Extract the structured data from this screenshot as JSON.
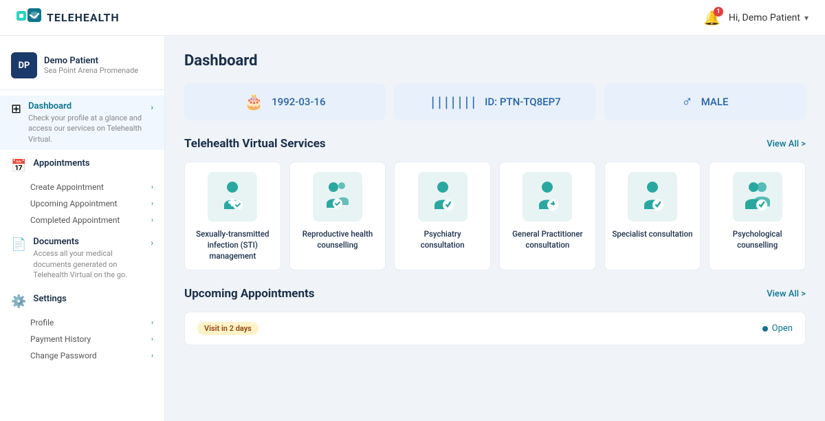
{
  "header": {
    "logo_text": "TELEHEALTH",
    "notification_badge": "1",
    "user_greeting": "Hi, Demo Patient"
  },
  "sidebar": {
    "user_initials": "DP",
    "user_name": "Demo Patient",
    "user_location": "Sea Point Arena Promenade",
    "nav_items": [
      {
        "id": "dashboard",
        "label": "Dashboard",
        "desc": "Check your profile at a glance and access our services on Telehealth Virtual.",
        "active": true,
        "sub_items": []
      },
      {
        "id": "appointments",
        "label": "Appointments",
        "desc": "",
        "active": false,
        "sub_items": [
          "Create Appointment",
          "Upcoming Appointment",
          "Completed Appointment"
        ]
      },
      {
        "id": "documents",
        "label": "Documents",
        "desc": "Access all your medical documents generated on Telehealth Virtual on the go.",
        "active": false,
        "sub_items": []
      },
      {
        "id": "settings",
        "label": "Settings",
        "desc": "",
        "active": false,
        "sub_items": [
          "Profile",
          "Payment History",
          "Change Password"
        ]
      }
    ]
  },
  "main": {
    "page_title": "Dashboard",
    "stats": [
      {
        "id": "dob",
        "icon": "🎂",
        "value": "1992-03-16"
      },
      {
        "id": "id",
        "icon": "|||",
        "value": "ID: PTN-TQ8EP7"
      },
      {
        "id": "gender",
        "icon": "♂",
        "value": "MALE"
      }
    ],
    "services_section": {
      "title": "Telehealth Virtual Services",
      "view_all": "View All >",
      "items": [
        {
          "id": "sti",
          "label": "Sexually-transmitted infection (STI) management"
        },
        {
          "id": "reproductive",
          "label": "Reproductive health counselling"
        },
        {
          "id": "psychiatry",
          "label": "Psychiatry consultation"
        },
        {
          "id": "gp",
          "label": "General Practitioner consultation"
        },
        {
          "id": "specialist",
          "label": "Specialist consultation"
        },
        {
          "id": "psychological",
          "label": "Psychological counselling"
        }
      ]
    },
    "upcoming_section": {
      "title": "Upcoming Appointments",
      "view_all": "View All >",
      "appointment": {
        "badge": "Visit in 2 days",
        "status": "Open"
      }
    }
  }
}
